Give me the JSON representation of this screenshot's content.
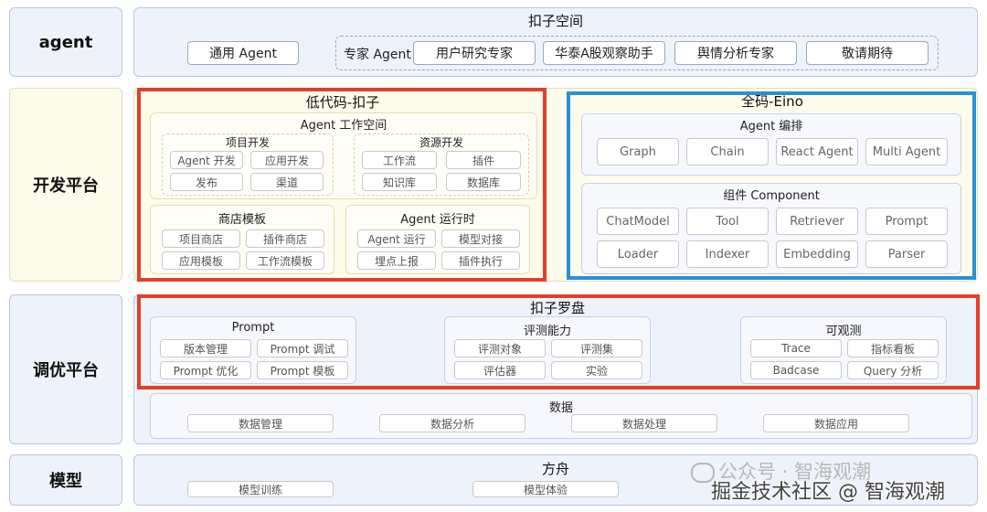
{
  "rows": {
    "agent": "agent",
    "dev": "开发平台",
    "tune": "调优平台",
    "model": "模型"
  },
  "agent_row": {
    "title": "扣子空间",
    "general": "通用 Agent",
    "expert_label": "专家 Agent",
    "experts": [
      "用户研究专家",
      "华泰A股观察助手",
      "舆情分析专家",
      "敬请期待"
    ]
  },
  "lowcode": {
    "title": "低代码-扣子",
    "workspace": {
      "title": "Agent 工作空间",
      "project": {
        "title": "项目开发",
        "items": [
          "Agent 开发",
          "应用开发",
          "发布",
          "渠道"
        ]
      },
      "resource": {
        "title": "资源开发",
        "items": [
          "工作流",
          "插件",
          "知识库",
          "数据库"
        ]
      }
    },
    "store": {
      "title": "商店模板",
      "items": [
        "项目商店",
        "插件商店",
        "应用模板",
        "工作流模板"
      ]
    },
    "runtime": {
      "title": "Agent 运行时",
      "items": [
        "Agent 运行",
        "模型对接",
        "埋点上报",
        "插件执行"
      ]
    }
  },
  "fullcode": {
    "title": "全码-Eino",
    "orchestration": {
      "title": "Agent 编排",
      "items": [
        "Graph",
        "Chain",
        "React Agent",
        "Multi Agent"
      ]
    },
    "component": {
      "title": "组件 Component",
      "items": [
        "ChatModel",
        "Tool",
        "Retriever",
        "Prompt",
        "Loader",
        "Indexer",
        "Embedding",
        "Parser"
      ]
    }
  },
  "compass": {
    "title": "扣子罗盘",
    "prompt": {
      "title": "Prompt",
      "items": [
        "版本管理",
        "Prompt 调试",
        "Prompt 优化",
        "Prompt 模板"
      ]
    },
    "eval": {
      "title": "评测能力",
      "items": [
        "评测对象",
        "评测集",
        "评估器",
        "实验"
      ]
    },
    "observe": {
      "title": "可观测",
      "items": [
        "Trace",
        "指标看板",
        "Badcase",
        "Query 分析"
      ]
    }
  },
  "data": {
    "title": "数据",
    "items": [
      "数据管理",
      "数据分析",
      "数据处理",
      "数据应用"
    ]
  },
  "ark": {
    "title": "方舟",
    "items": [
      "模型训练",
      "模型体验"
    ]
  },
  "watermarks": {
    "wechat": "公众号 · 智海观潮",
    "juejin": "掘金技术社区 @ 智海观潮"
  },
  "colors": {
    "highlight_red": "#e0402a",
    "highlight_blue": "#2a90d6",
    "panel_blue": "#eef2fa",
    "panel_yellow": "#fdfbea"
  }
}
